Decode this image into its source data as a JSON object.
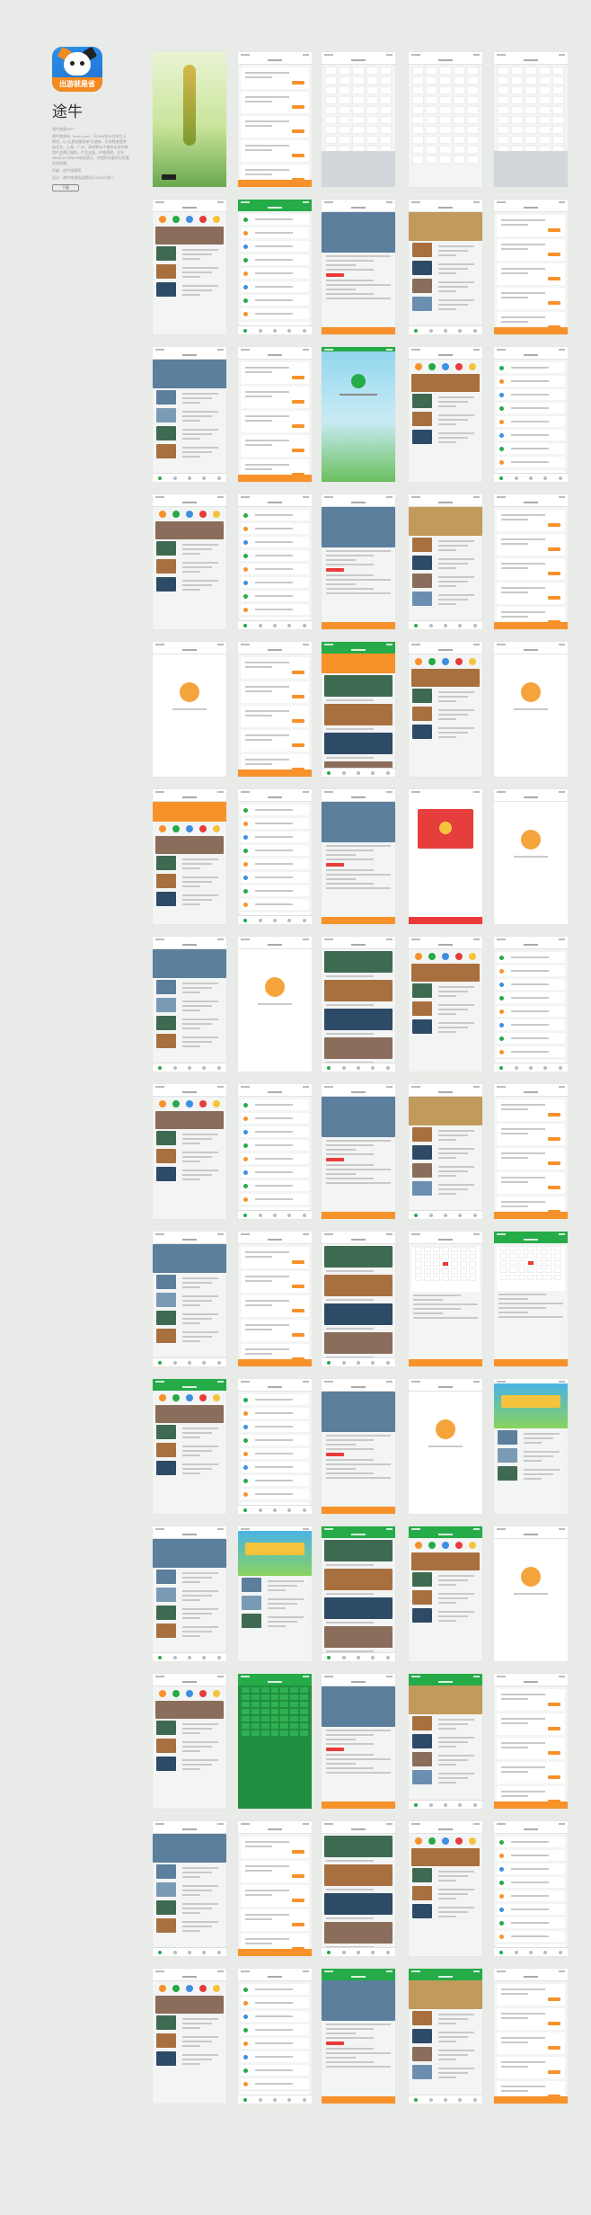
{
  "sidebar": {
    "icon_badge": "出游就是省",
    "app_name": "途牛",
    "description": [
      "途牛旅游APP",
      "途牛旅游网（tuniu.com）于2006年10月创立于南京，以“让旅游更简单”为使命，为消费者提供由北京、上海、广州、深圳等64个城市出发的旅游产品预订服务，产品全面，价格透明，全年365天24小时400电话预订，并提供丰富的后续服务和保障。",
      "作者：途牛旅游网",
      "设计：途牛旅游网品牌设计与UED部门"
    ],
    "download_label": "下载"
  },
  "colors": {
    "background": "#e9ebe8",
    "brand_green": "#25ab48",
    "accent_orange": "#f7922b",
    "alert_red": "#ea3b3b",
    "link_blue": "#3d8fe0"
  },
  "gallery": {
    "columns": 5,
    "rows": 14,
    "screen_labels": [
      [
        "启动页",
        "首页",
        "日历选择",
        "城市选择",
        "城市选择"
      ],
      [
        "首页",
        "登录",
        "我的",
        "搜索",
        "筛选"
      ],
      [
        "度假列表",
        "度假列表",
        "欢迎页",
        "度假列表",
        "目的地"
      ],
      [
        "目的地",
        "酒店",
        "订单详情",
        "账户设置",
        "我的"
      ],
      [
        "空状态",
        "发现",
        "会员中心",
        "订单",
        "空状态"
      ],
      [
        "引导",
        "订单填写",
        "活动",
        "红包",
        "空状态"
      ],
      [
        "分享",
        "收藏",
        "游记详情",
        "游记详情",
        "游记列表"
      ],
      [
        "游记",
        "社区",
        "活动",
        "游记详情",
        "点评"
      ],
      [
        "产品详情",
        "产品详情",
        "预订须知",
        "日历价格",
        "日历价格"
      ],
      [
        "订单",
        "机票详情",
        "订单填写",
        "空状态",
        "活动"
      ],
      [
        "目的地",
        "专题",
        "机票列表",
        "机票列表",
        "空状态"
      ],
      [
        "产品列表",
        "日历",
        "门票列表",
        "门票列表",
        "筛选"
      ],
      [
        "目的地",
        "景点",
        "专题",
        "资讯列表",
        "专题"
      ],
      [
        "专题",
        "门票",
        "专题",
        "专题列表",
        "门票列表"
      ]
    ]
  }
}
